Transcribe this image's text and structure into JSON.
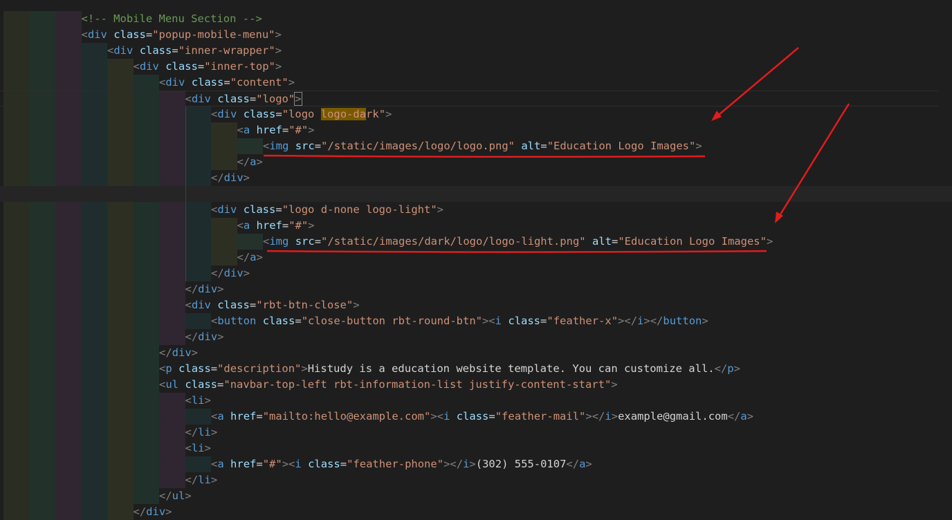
{
  "editor": {
    "lines": [
      {
        "indent": 3,
        "tokens": [
          {
            "t": "<!-- Mobile Menu Section -->",
            "c": "comment"
          }
        ]
      },
      {
        "indent": 3,
        "tokens": [
          {
            "t": "<",
            "c": "punc"
          },
          {
            "t": "div",
            "c": "tag"
          },
          {
            "t": " ",
            "c": "text"
          },
          {
            "t": "class",
            "c": "attr"
          },
          {
            "t": "=",
            "c": "eq"
          },
          {
            "t": "\"popup-mobile-menu\"",
            "c": "str"
          },
          {
            "t": ">",
            "c": "punc"
          }
        ]
      },
      {
        "indent": 4,
        "tokens": [
          {
            "t": "<",
            "c": "punc"
          },
          {
            "t": "div",
            "c": "tag"
          },
          {
            "t": " ",
            "c": "text"
          },
          {
            "t": "class",
            "c": "attr"
          },
          {
            "t": "=",
            "c": "eq"
          },
          {
            "t": "\"inner-wrapper\"",
            "c": "str"
          },
          {
            "t": ">",
            "c": "punc"
          }
        ]
      },
      {
        "indent": 5,
        "tokens": [
          {
            "t": "<",
            "c": "punc"
          },
          {
            "t": "div",
            "c": "tag"
          },
          {
            "t": " ",
            "c": "text"
          },
          {
            "t": "class",
            "c": "attr"
          },
          {
            "t": "=",
            "c": "eq"
          },
          {
            "t": "\"inner-top\"",
            "c": "str"
          },
          {
            "t": ">",
            "c": "punc"
          }
        ]
      },
      {
        "indent": 6,
        "tokens": [
          {
            "t": "<",
            "c": "punc"
          },
          {
            "t": "div",
            "c": "tag"
          },
          {
            "t": " ",
            "c": "text"
          },
          {
            "t": "class",
            "c": "attr"
          },
          {
            "t": "=",
            "c": "eq"
          },
          {
            "t": "\"content\"",
            "c": "str"
          },
          {
            "t": ">",
            "c": "punc"
          }
        ]
      },
      {
        "indent": 7,
        "current": true,
        "tokens": [
          {
            "t": "<",
            "c": "punc"
          },
          {
            "t": "div",
            "c": "tag"
          },
          {
            "t": " ",
            "c": "text"
          },
          {
            "t": "class",
            "c": "attr"
          },
          {
            "t": "=",
            "c": "eq"
          },
          {
            "t": "\"logo\"",
            "c": "str"
          },
          {
            "t": ">",
            "c": "punc",
            "box": true
          }
        ]
      },
      {
        "indent": 8,
        "tokens": [
          {
            "t": "<",
            "c": "punc"
          },
          {
            "t": "div",
            "c": "tag"
          },
          {
            "t": " ",
            "c": "text"
          },
          {
            "t": "class",
            "c": "attr"
          },
          {
            "t": "=",
            "c": "eq"
          },
          {
            "t": "\"logo ",
            "c": "str"
          },
          {
            "t": "logo-da",
            "c": "str",
            "hl": true
          },
          {
            "t": "rk\"",
            "c": "str"
          },
          {
            "t": ">",
            "c": "punc"
          }
        ]
      },
      {
        "indent": 9,
        "tokens": [
          {
            "t": "<",
            "c": "punc"
          },
          {
            "t": "a",
            "c": "tag"
          },
          {
            "t": " ",
            "c": "text"
          },
          {
            "t": "href",
            "c": "attr"
          },
          {
            "t": "=",
            "c": "eq"
          },
          {
            "t": "\"#\"",
            "c": "str"
          },
          {
            "t": ">",
            "c": "punc"
          }
        ]
      },
      {
        "indent": 10,
        "tokens": [
          {
            "t": "<",
            "c": "punc"
          },
          {
            "t": "img",
            "c": "tag"
          },
          {
            "t": " ",
            "c": "text"
          },
          {
            "t": "src",
            "c": "attr"
          },
          {
            "t": "=",
            "c": "eq"
          },
          {
            "t": "\"/static/images/logo/logo.png\"",
            "c": "str"
          },
          {
            "t": " ",
            "c": "text"
          },
          {
            "t": "alt",
            "c": "attr"
          },
          {
            "t": "=",
            "c": "eq"
          },
          {
            "t": "\"Education Logo Images\"",
            "c": "str"
          },
          {
            "t": ">",
            "c": "punc"
          }
        ]
      },
      {
        "indent": 9,
        "tokens": [
          {
            "t": "</",
            "c": "punc"
          },
          {
            "t": "a",
            "c": "tag"
          },
          {
            "t": ">",
            "c": "punc"
          }
        ]
      },
      {
        "indent": 8,
        "tokens": [
          {
            "t": "</",
            "c": "punc"
          },
          {
            "t": "div",
            "c": "tag"
          },
          {
            "t": ">",
            "c": "punc"
          }
        ]
      },
      {
        "indent": 0,
        "blank": true,
        "tokens": []
      },
      {
        "indent": 8,
        "tokens": [
          {
            "t": "<",
            "c": "punc"
          },
          {
            "t": "div",
            "c": "tag"
          },
          {
            "t": " ",
            "c": "text"
          },
          {
            "t": "class",
            "c": "attr"
          },
          {
            "t": "=",
            "c": "eq"
          },
          {
            "t": "\"logo d-none logo-light\"",
            "c": "str"
          },
          {
            "t": ">",
            "c": "punc"
          }
        ]
      },
      {
        "indent": 9,
        "tokens": [
          {
            "t": "<",
            "c": "punc"
          },
          {
            "t": "a",
            "c": "tag"
          },
          {
            "t": " ",
            "c": "text"
          },
          {
            "t": "href",
            "c": "attr"
          },
          {
            "t": "=",
            "c": "eq"
          },
          {
            "t": "\"#\"",
            "c": "str"
          },
          {
            "t": ">",
            "c": "punc"
          }
        ]
      },
      {
        "indent": 10,
        "tokens": [
          {
            "t": "<",
            "c": "punc"
          },
          {
            "t": "img",
            "c": "tag"
          },
          {
            "t": " ",
            "c": "text"
          },
          {
            "t": "src",
            "c": "attr"
          },
          {
            "t": "=",
            "c": "eq"
          },
          {
            "t": "\"/static/images/dark/logo/logo-light.png\"",
            "c": "str"
          },
          {
            "t": " ",
            "c": "text"
          },
          {
            "t": "alt",
            "c": "attr"
          },
          {
            "t": "=",
            "c": "eq"
          },
          {
            "t": "\"Education Logo Images\"",
            "c": "str"
          },
          {
            "t": ">",
            "c": "punc"
          }
        ]
      },
      {
        "indent": 9,
        "tokens": [
          {
            "t": "</",
            "c": "punc"
          },
          {
            "t": "a",
            "c": "tag"
          },
          {
            "t": ">",
            "c": "punc"
          }
        ]
      },
      {
        "indent": 8,
        "tokens": [
          {
            "t": "</",
            "c": "punc"
          },
          {
            "t": "div",
            "c": "tag"
          },
          {
            "t": ">",
            "c": "punc"
          }
        ]
      },
      {
        "indent": 7,
        "tokens": [
          {
            "t": "</",
            "c": "punc"
          },
          {
            "t": "div",
            "c": "tag"
          },
          {
            "t": ">",
            "c": "punc"
          }
        ]
      },
      {
        "indent": 7,
        "tokens": [
          {
            "t": "<",
            "c": "punc"
          },
          {
            "t": "div",
            "c": "tag"
          },
          {
            "t": " ",
            "c": "text"
          },
          {
            "t": "class",
            "c": "attr"
          },
          {
            "t": "=",
            "c": "eq"
          },
          {
            "t": "\"rbt-btn-close\"",
            "c": "str"
          },
          {
            "t": ">",
            "c": "punc"
          }
        ]
      },
      {
        "indent": 8,
        "tokens": [
          {
            "t": "<",
            "c": "punc"
          },
          {
            "t": "button",
            "c": "tag"
          },
          {
            "t": " ",
            "c": "text"
          },
          {
            "t": "class",
            "c": "attr"
          },
          {
            "t": "=",
            "c": "eq"
          },
          {
            "t": "\"close-button rbt-round-btn\"",
            "c": "str"
          },
          {
            "t": "><",
            "c": "punc"
          },
          {
            "t": "i",
            "c": "tag"
          },
          {
            "t": " ",
            "c": "text"
          },
          {
            "t": "class",
            "c": "attr"
          },
          {
            "t": "=",
            "c": "eq"
          },
          {
            "t": "\"feather-x\"",
            "c": "str"
          },
          {
            "t": "></",
            "c": "punc"
          },
          {
            "t": "i",
            "c": "tag"
          },
          {
            "t": "></",
            "c": "punc"
          },
          {
            "t": "button",
            "c": "tag"
          },
          {
            "t": ">",
            "c": "punc"
          }
        ]
      },
      {
        "indent": 7,
        "tokens": [
          {
            "t": "</",
            "c": "punc"
          },
          {
            "t": "div",
            "c": "tag"
          },
          {
            "t": ">",
            "c": "punc"
          }
        ]
      },
      {
        "indent": 6,
        "tokens": [
          {
            "t": "</",
            "c": "punc"
          },
          {
            "t": "div",
            "c": "tag"
          },
          {
            "t": ">",
            "c": "punc"
          }
        ]
      },
      {
        "indent": 6,
        "tokens": [
          {
            "t": "<",
            "c": "punc"
          },
          {
            "t": "p",
            "c": "tag"
          },
          {
            "t": " ",
            "c": "text"
          },
          {
            "t": "class",
            "c": "attr"
          },
          {
            "t": "=",
            "c": "eq"
          },
          {
            "t": "\"description\"",
            "c": "str"
          },
          {
            "t": ">",
            "c": "punc"
          },
          {
            "t": "Histudy is a education website template. You can customize all.",
            "c": "text"
          },
          {
            "t": "</",
            "c": "punc"
          },
          {
            "t": "p",
            "c": "tag"
          },
          {
            "t": ">",
            "c": "punc"
          }
        ]
      },
      {
        "indent": 6,
        "tokens": [
          {
            "t": "<",
            "c": "punc"
          },
          {
            "t": "ul",
            "c": "tag"
          },
          {
            "t": " ",
            "c": "text"
          },
          {
            "t": "class",
            "c": "attr"
          },
          {
            "t": "=",
            "c": "eq"
          },
          {
            "t": "\"navbar-top-left rbt-information-list justify-content-start\"",
            "c": "str"
          },
          {
            "t": ">",
            "c": "punc"
          }
        ]
      },
      {
        "indent": 7,
        "tokens": [
          {
            "t": "<",
            "c": "punc"
          },
          {
            "t": "li",
            "c": "tag"
          },
          {
            "t": ">",
            "c": "punc"
          }
        ]
      },
      {
        "indent": 8,
        "tokens": [
          {
            "t": "<",
            "c": "punc"
          },
          {
            "t": "a",
            "c": "tag"
          },
          {
            "t": " ",
            "c": "text"
          },
          {
            "t": "href",
            "c": "attr"
          },
          {
            "t": "=",
            "c": "eq"
          },
          {
            "t": "\"mailto:hello@example.com\"",
            "c": "str"
          },
          {
            "t": "><",
            "c": "punc"
          },
          {
            "t": "i",
            "c": "tag"
          },
          {
            "t": " ",
            "c": "text"
          },
          {
            "t": "class",
            "c": "attr"
          },
          {
            "t": "=",
            "c": "eq"
          },
          {
            "t": "\"feather-mail\"",
            "c": "str"
          },
          {
            "t": "></",
            "c": "punc"
          },
          {
            "t": "i",
            "c": "tag"
          },
          {
            "t": ">",
            "c": "punc"
          },
          {
            "t": "example@gmail.com",
            "c": "text"
          },
          {
            "t": "</",
            "c": "punc"
          },
          {
            "t": "a",
            "c": "tag"
          },
          {
            "t": ">",
            "c": "punc"
          }
        ]
      },
      {
        "indent": 7,
        "tokens": [
          {
            "t": "</",
            "c": "punc"
          },
          {
            "t": "li",
            "c": "tag"
          },
          {
            "t": ">",
            "c": "punc"
          }
        ]
      },
      {
        "indent": 7,
        "tokens": [
          {
            "t": "<",
            "c": "punc"
          },
          {
            "t": "li",
            "c": "tag"
          },
          {
            "t": ">",
            "c": "punc"
          }
        ]
      },
      {
        "indent": 8,
        "tokens": [
          {
            "t": "<",
            "c": "punc"
          },
          {
            "t": "a",
            "c": "tag"
          },
          {
            "t": " ",
            "c": "text"
          },
          {
            "t": "href",
            "c": "attr"
          },
          {
            "t": "=",
            "c": "eq"
          },
          {
            "t": "\"#\"",
            "c": "str"
          },
          {
            "t": "><",
            "c": "punc"
          },
          {
            "t": "i",
            "c": "tag"
          },
          {
            "t": " ",
            "c": "text"
          },
          {
            "t": "class",
            "c": "attr"
          },
          {
            "t": "=",
            "c": "eq"
          },
          {
            "t": "\"feather-phone\"",
            "c": "str"
          },
          {
            "t": "></",
            "c": "punc"
          },
          {
            "t": "i",
            "c": "tag"
          },
          {
            "t": ">",
            "c": "punc"
          },
          {
            "t": "(302) 555-0107",
            "c": "text"
          },
          {
            "t": "</",
            "c": "punc"
          },
          {
            "t": "a",
            "c": "tag"
          },
          {
            "t": ">",
            "c": "punc"
          }
        ]
      },
      {
        "indent": 7,
        "tokens": [
          {
            "t": "</",
            "c": "punc"
          },
          {
            "t": "li",
            "c": "tag"
          },
          {
            "t": ">",
            "c": "punc"
          }
        ]
      },
      {
        "indent": 6,
        "tokens": [
          {
            "t": "</",
            "c": "punc"
          },
          {
            "t": "ul",
            "c": "tag"
          },
          {
            "t": ">",
            "c": "punc"
          }
        ]
      },
      {
        "indent": 5,
        "tokens": [
          {
            "t": "</",
            "c": "punc"
          },
          {
            "t": "div",
            "c": "tag"
          },
          {
            "t": ">",
            "c": "punc"
          }
        ]
      }
    ]
  },
  "indent_rainbow_colors": [
    "#2a2d22",
    "#23312b",
    "#2f2631",
    "#1f2d2e",
    "#2d2f22",
    "#20302a",
    "#2f2632",
    "#1f2c2e",
    "#2e2f23",
    "#24322c",
    "#2e2632"
  ],
  "annotations": {
    "underline_color": "#e51b1b",
    "arrow_color": "#e51b1b"
  }
}
